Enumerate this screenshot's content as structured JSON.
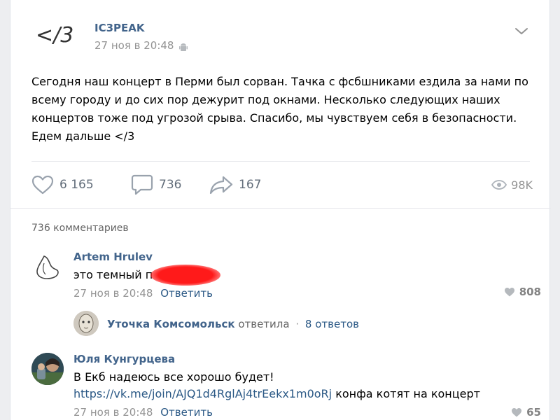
{
  "post": {
    "author": "IC3PEAK",
    "date": "27 ноя в 20:48",
    "text": "Сегодня наш концерт в Перми был сорван. Тачка с фсбшниками ездила за нами по всему городу и до сих пор дежурит под окнами. Несколько следующих наших концертов тоже под угрозой срыва. Спасибо, мы чувствуем себя в безопасности. Едем дальше </3",
    "logo_text": "</3",
    "likes": "6 165",
    "comments": "736",
    "shares": "167",
    "views": "98K"
  },
  "comments_header": "736 комментариев",
  "comments": [
    {
      "author": "Artem Hrulev",
      "text": "это темный п",
      "text_tail": ".",
      "date": "27 ноя в 20:48",
      "reply_label": "Ответить",
      "likes": "808"
    },
    {
      "author": "Юля Кунгурцева",
      "text": "В Екб надеюсь все хорошо будет!",
      "link": "https://vk.me/join/AJQ1d4RglAj4trEekx1m0oRj",
      "link_tail": " конфа котят на концерт",
      "date": "27 ноя в 20:48",
      "reply_label": "Ответить",
      "likes": "65"
    }
  ],
  "thread": {
    "name": "Уточка Комсомольск",
    "verb": "ответила",
    "count": "8 ответов"
  },
  "colors": {
    "link": "#2a5885",
    "author": "#42648b",
    "muted": "#939393",
    "redaction": "#ff1a1a"
  },
  "icons": [
    "logo-icon",
    "android-icon",
    "chevron-down-icon",
    "heart-icon",
    "comment-icon",
    "share-icon",
    "eye-icon"
  ]
}
